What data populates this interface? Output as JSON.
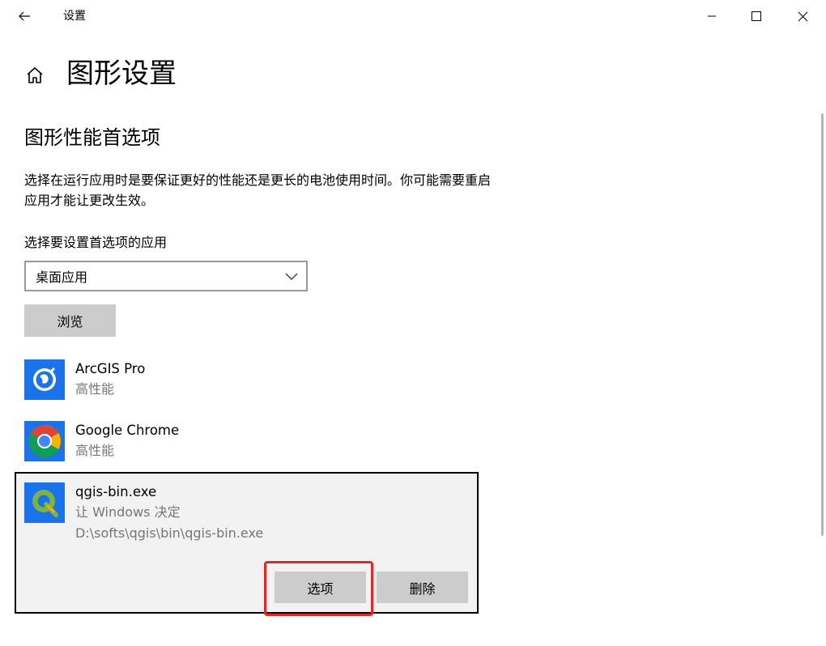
{
  "window": {
    "title": "设置"
  },
  "page": {
    "title": "图形设置",
    "section_title": "图形性能首选项",
    "description": "选择在运行应用时是要保证更好的性能还是更长的电池使用时间。你可能需要重启应用才能让更改生效。",
    "select_label": "选择要设置首选项的应用",
    "dropdown_value": "桌面应用",
    "browse_label": "浏览"
  },
  "apps": [
    {
      "name": "ArcGIS Pro",
      "preference": "高性能",
      "icon": "arcgis-icon"
    },
    {
      "name": "Google Chrome",
      "preference": "高性能",
      "icon": "chrome-icon"
    },
    {
      "name": "qgis-bin.exe",
      "preference": "让 Windows 决定",
      "path": "D:\\softs\\qgis\\bin\\qgis-bin.exe",
      "icon": "qgis-icon"
    }
  ],
  "actions": {
    "options_label": "选项",
    "remove_label": "删除"
  },
  "colors": {
    "button_bg": "#cccccc",
    "secondary_text": "#767676",
    "highlight": "#e32626",
    "icon_blue": "#1a73e8"
  }
}
